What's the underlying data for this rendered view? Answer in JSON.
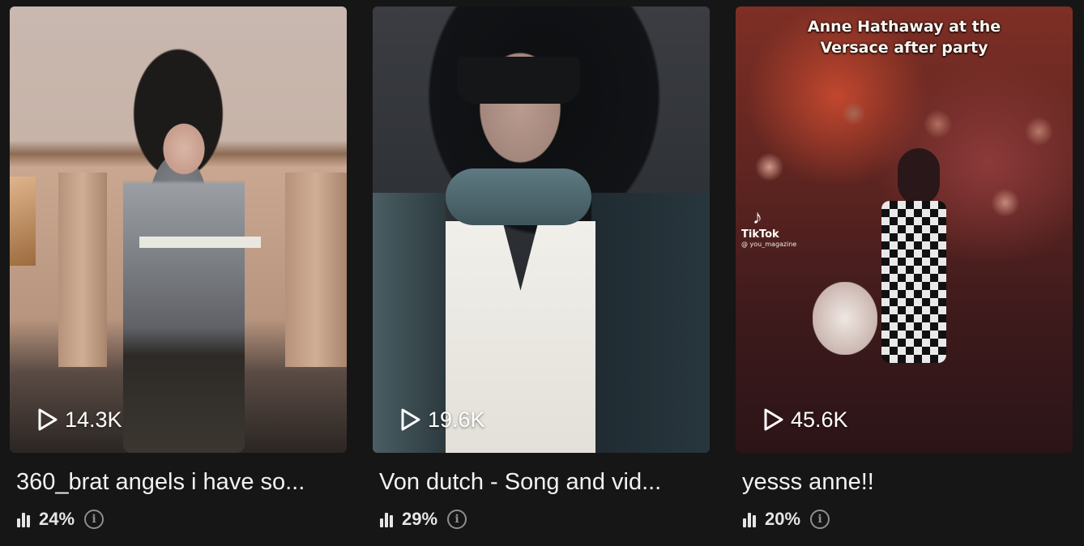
{
  "icons": {
    "play": "play-icon",
    "engagement": "bar-chart-icon",
    "info": "info-icon"
  },
  "colors": {
    "background": "#161616",
    "text": "#ffffff",
    "muted": "#8e8e8e"
  },
  "videos": [
    {
      "views": "14.3K",
      "title": "360_brat angels i have so...",
      "percent": "24%"
    },
    {
      "views": "19.6K",
      "title": "Von dutch - Song and vid...",
      "percent": "29%"
    },
    {
      "views": "45.6K",
      "title": "yesss anne!!",
      "percent": "20%",
      "overlay_text": "Anne Hathaway at the\nVersace after party",
      "watermark_name": "TikTok",
      "watermark_handle": "@ you_magazine"
    }
  ]
}
